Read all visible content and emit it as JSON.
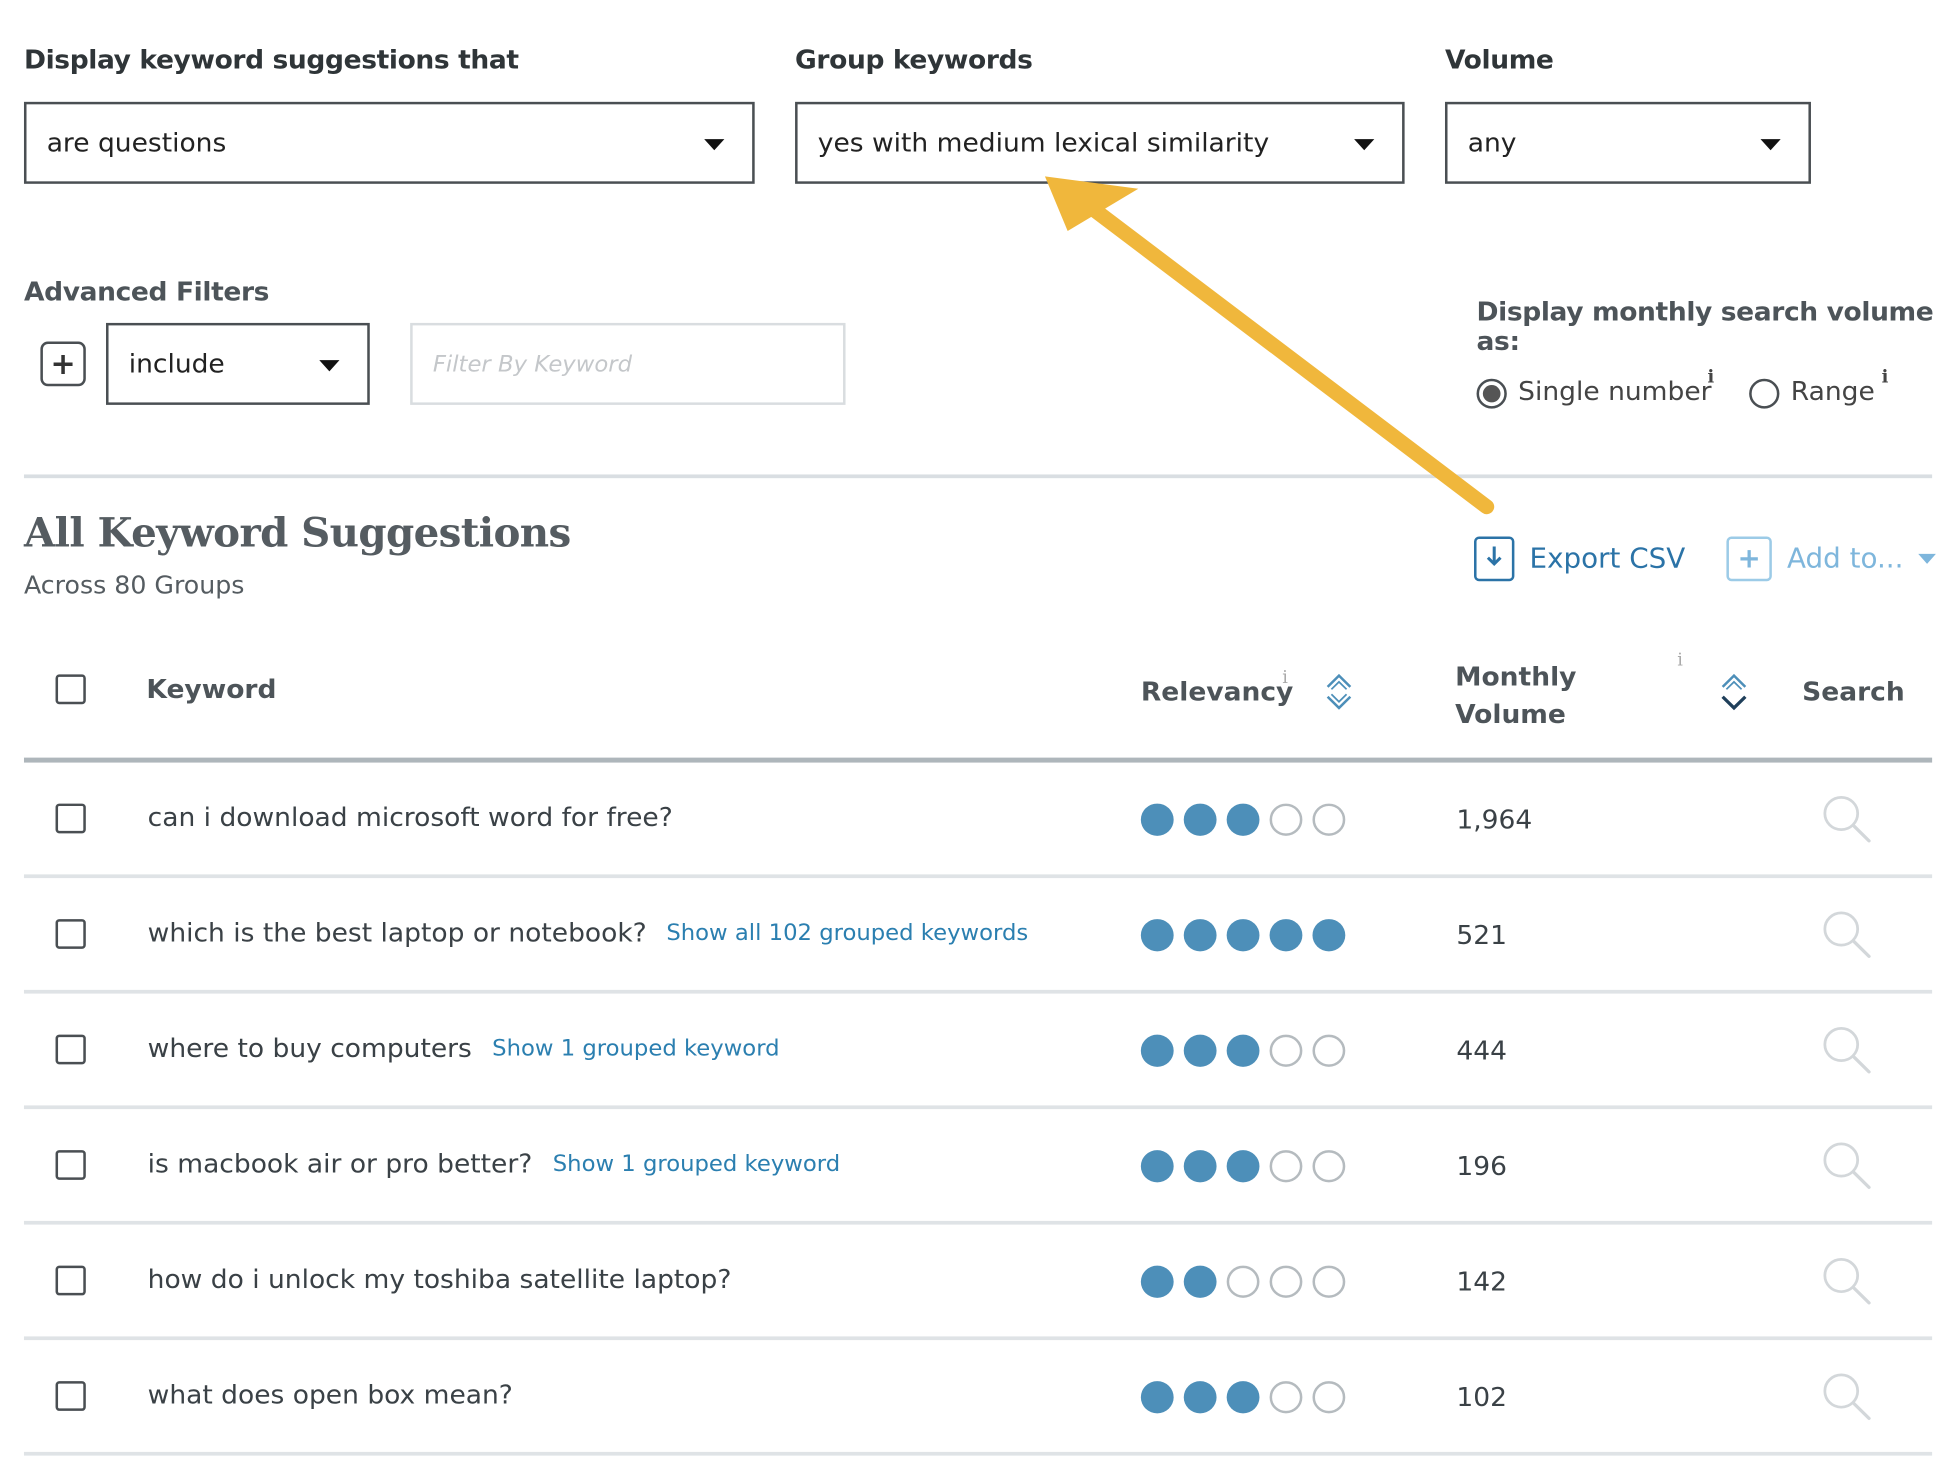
{
  "filters": {
    "display_label": "Display keyword suggestions that",
    "display_value": "are questions",
    "group_label": "Group keywords",
    "group_value": "yes with medium lexical similarity",
    "volume_label": "Volume",
    "volume_value": "any"
  },
  "advanced": {
    "label": "Advanced Filters",
    "mode_value": "include",
    "keyword_placeholder": "Filter By Keyword"
  },
  "volume_display": {
    "label": "Display monthly search volume as:",
    "option_single": "Single number",
    "option_range": "Range",
    "selected": "Single number"
  },
  "section": {
    "title": "All Keyword Suggestions",
    "subtitle": "Across 80 Groups",
    "export_label": "Export CSV",
    "addto_label": "Add to..."
  },
  "table": {
    "col_keyword": "Keyword",
    "col_relevancy": "Relevancy",
    "col_volume_line1": "Monthly",
    "col_volume_line2": "Volume",
    "col_search": "Search",
    "rows": [
      {
        "keyword": "can i download microsoft word for free?",
        "group": "",
        "relevancy": 3,
        "volume": "1,964"
      },
      {
        "keyword": "which is the best laptop or notebook?",
        "group": "Show all 102 grouped keywords",
        "relevancy": 5,
        "volume": "521"
      },
      {
        "keyword": "where to buy computers",
        "group": "Show 1 grouped keyword",
        "relevancy": 3,
        "volume": "444"
      },
      {
        "keyword": "is macbook air or pro better?",
        "group": "Show 1 grouped keyword",
        "relevancy": 3,
        "volume": "196"
      },
      {
        "keyword": "how do i unlock my toshiba satellite laptop?",
        "group": "",
        "relevancy": 2,
        "volume": "142"
      },
      {
        "keyword": "what does open box mean?",
        "group": "",
        "relevancy": 3,
        "volume": "102"
      }
    ]
  },
  "colors": {
    "accent_link": "#2b73a7",
    "relevancy_dot": "#4d8fb9",
    "annotation_arrow": "#f0b73c"
  },
  "icons": [
    "dropdown-caret-icon",
    "plus-icon",
    "info-icon",
    "export-file-icon",
    "sort-icon",
    "search-icon"
  ]
}
